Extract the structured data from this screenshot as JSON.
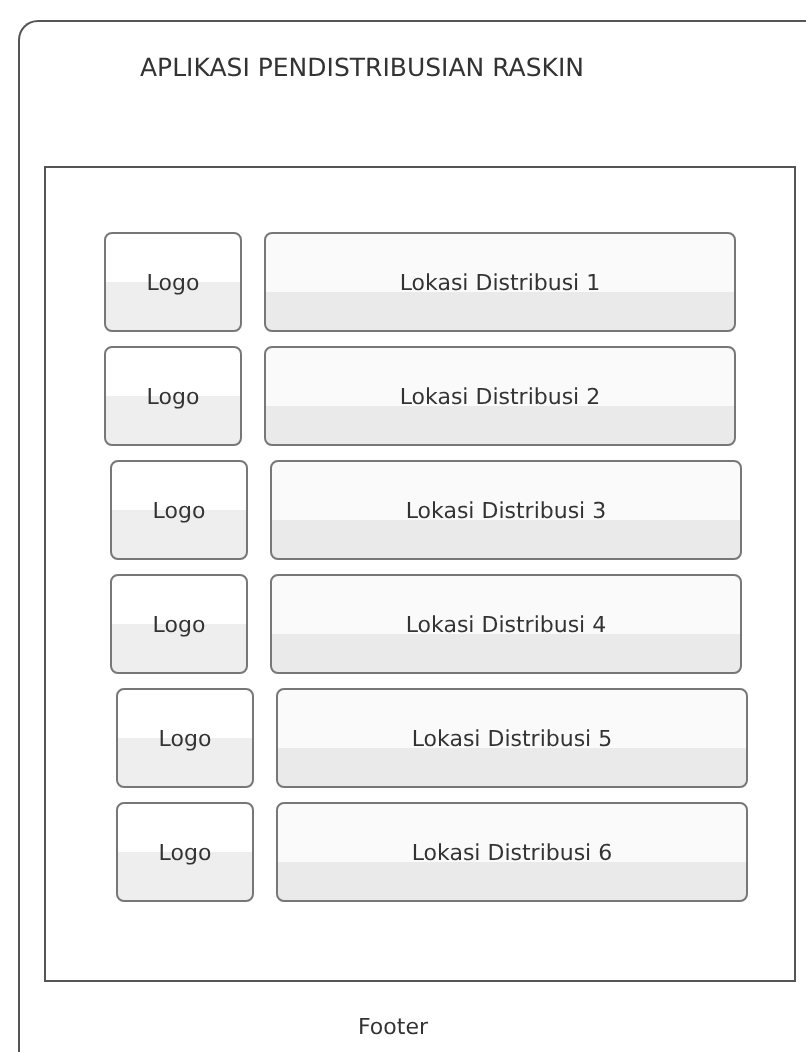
{
  "header": {
    "title": "APLIKASI PENDISTRIBUSIAN RASKIN"
  },
  "locations": [
    {
      "logo": "Logo",
      "label": "Lokasi Distribusi 1"
    },
    {
      "logo": "Logo",
      "label": "Lokasi Distribusi 2"
    },
    {
      "logo": "Logo",
      "label": "Lokasi Distribusi 3"
    },
    {
      "logo": "Logo",
      "label": "Lokasi Distribusi 4"
    },
    {
      "logo": "Logo",
      "label": "Lokasi Distribusi 5"
    },
    {
      "logo": "Logo",
      "label": "Lokasi Distribusi 6"
    }
  ],
  "footer": {
    "text": "Footer"
  }
}
